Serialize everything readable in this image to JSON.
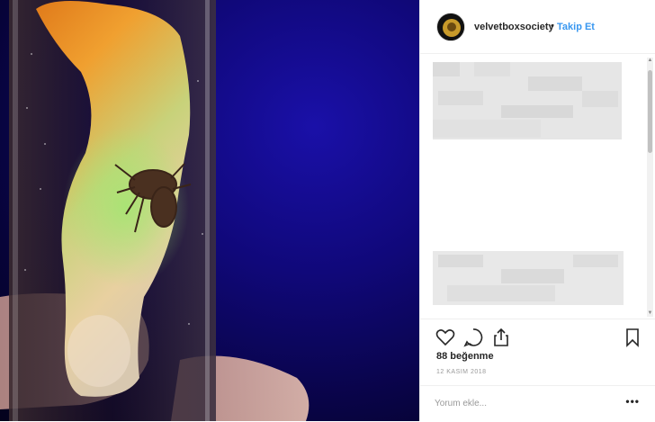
{
  "post": {
    "image_icon": "amber-spider-photo",
    "header": {
      "username": "velvetboxsociety",
      "separator": "•",
      "follow_label": "Takip Et",
      "avatar_icon": "profile-avatar-icon"
    },
    "caption": {
      "content_state": "pixelated"
    },
    "actions": {
      "like_icon": "heart-icon",
      "comment_icon": "comment-icon",
      "share_icon": "share-icon",
      "save_icon": "bookmark-icon"
    },
    "likes_text": "88 beğenme",
    "date_text": "12 KASIM 2018",
    "comment": {
      "placeholder": "Yorum ekle...",
      "more_label": "•••"
    }
  },
  "colors": {
    "link": "#3897f0",
    "text": "#262626",
    "muted": "#999999",
    "border": "#efefef",
    "photo_bg": "#0d0770"
  }
}
